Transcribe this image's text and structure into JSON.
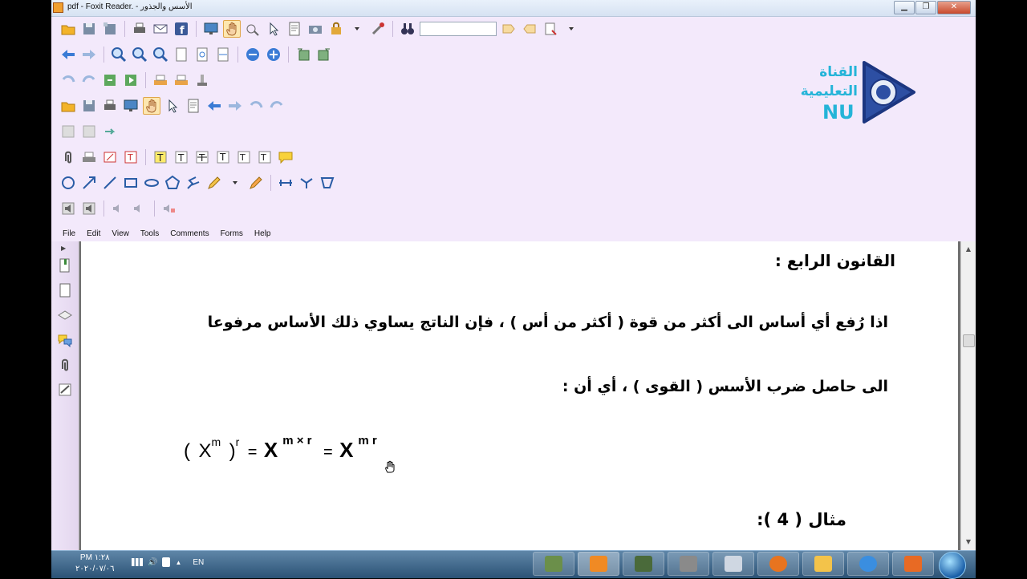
{
  "window": {
    "title": "pdf - Foxit Reader. - الأسس والجذور",
    "min": "▁",
    "max": "❐",
    "close": "✕"
  },
  "menu": [
    "File",
    "Edit",
    "View",
    "Tools",
    "Comments",
    "Forms",
    "Help"
  ],
  "logo": {
    "line1": "القناة",
    "line2": "التعليمية",
    "brand": "NU"
  },
  "document": {
    "heading": "القانون الرابع :",
    "line1": "اذا رُفع أي أساس الى أكثر من قوة ( أكثر من أس ) ، فإن الناتج يساوي ذلك الأساس مرفوعا",
    "line2": "الى حاصل ضرب الأسس ( القوى ) ، أي أن :",
    "formula": {
      "open": "(",
      "base1": "X",
      "exp1": "m",
      "close": ")",
      "exp_r": "r",
      "eq1": "=",
      "base2": "X",
      "exp2": "m × r",
      "eq2": "=",
      "base3": "X",
      "exp3": "m r"
    },
    "example": "مثال ( 4 ):"
  },
  "taskbar": {
    "time": "PM ١:٢٨",
    "date": "٢٠٢٠/٠٧/٠٦",
    "lang": "EN",
    "up_arrow": "▲"
  }
}
